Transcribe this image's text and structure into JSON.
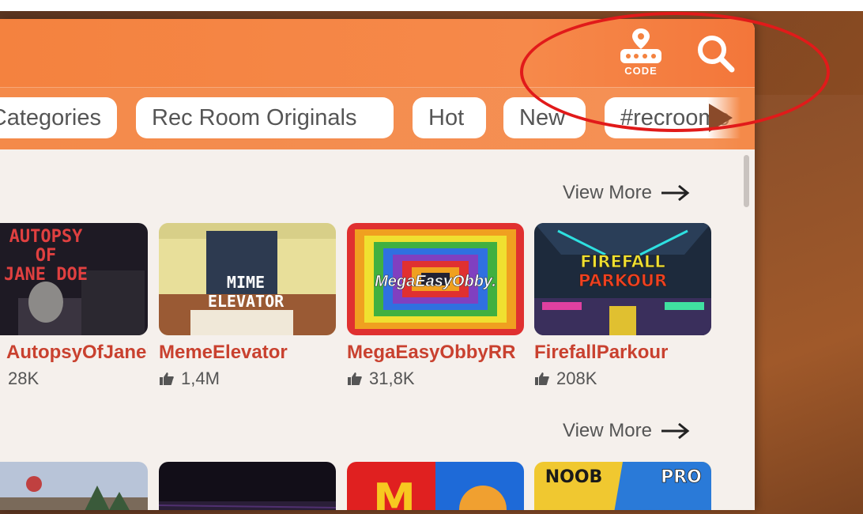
{
  "header": {
    "code_label": "CODE",
    "code_icon": "code-pin-icon",
    "search_icon": "search-icon"
  },
  "categories": [
    "Categories",
    "Rec Room Originals",
    "Hot",
    "New",
    "#recroomo"
  ],
  "sections": [
    {
      "view_more": "View More",
      "rooms": [
        {
          "title": "AutopsyOfJaneD...",
          "likes": "28K",
          "thumb_text": [
            "AUTOPSY",
            "OF",
            "JANE DOE"
          ]
        },
        {
          "title": "MemeElevator",
          "likes": "1,4M",
          "thumb_text": [
            "MIME",
            "ELEVATOR"
          ]
        },
        {
          "title": "MegaEasyObbyRR",
          "likes": "31,8K",
          "thumb_text": [
            "MegaEasyObby."
          ]
        },
        {
          "title": "FirefallParkour",
          "likes": "208K",
          "thumb_text": [
            "FIREFALL",
            "PARKOUR"
          ]
        }
      ]
    },
    {
      "view_more": "View More",
      "rooms": [
        {
          "thumb_text": []
        },
        {
          "thumb_text": []
        },
        {
          "thumb_text": [
            "M"
          ]
        },
        {
          "thumb_text": [
            "NOOB",
            "PRO"
          ]
        }
      ]
    }
  ],
  "colors": {
    "header_orange": "#f4823f",
    "title_red": "#c9412f",
    "annotation_red": "#e11a1a",
    "panel_bg": "#f5f0ec"
  }
}
